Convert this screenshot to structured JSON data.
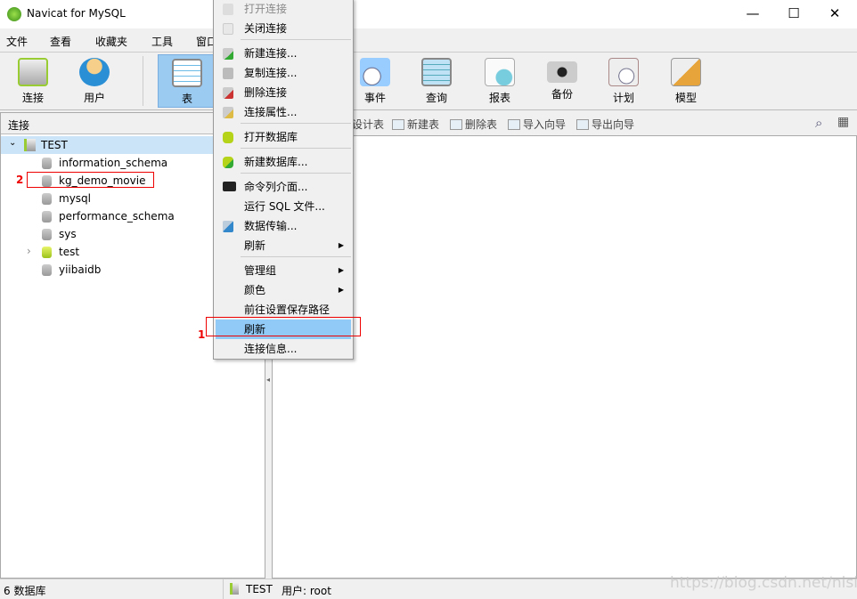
{
  "window": {
    "title": "Navicat for MySQL",
    "minimize": "—",
    "maximize": "☐",
    "close": "✕"
  },
  "menubar": [
    "文件",
    "查看",
    "收藏夹",
    "工具",
    "窗口"
  ],
  "toolbar": {
    "left": [
      {
        "label": "连接",
        "icon": "connection-icon"
      },
      {
        "label": "用户",
        "icon": "user-icon"
      },
      {
        "label": "表",
        "icon": "table-icon",
        "selected": true
      }
    ],
    "right": [
      {
        "label": "事件",
        "icon": "event-icon"
      },
      {
        "label": "查询",
        "icon": "query-icon"
      },
      {
        "label": "报表",
        "icon": "report-icon"
      },
      {
        "label": "备份",
        "icon": "backup-icon"
      },
      {
        "label": "计划",
        "icon": "schedule-icon"
      },
      {
        "label": "模型",
        "icon": "model-icon"
      }
    ]
  },
  "left_panel": {
    "header": "连接",
    "connection": "TEST",
    "databases": [
      "information_schema",
      "kg_demo_movie",
      "mysql",
      "performance_schema",
      "sys",
      "test",
      "yiibaidb"
    ]
  },
  "sub_toolbar": [
    "设计表",
    "新建表",
    "删除表",
    "导入向导",
    "导出向导"
  ],
  "context_menu": [
    {
      "label": "打开连接",
      "disabled": true
    },
    {
      "label": "关闭连接"
    },
    {
      "sep": true
    },
    {
      "label": "新建连接..."
    },
    {
      "label": "复制连接..."
    },
    {
      "label": "删除连接"
    },
    {
      "label": "连接属性..."
    },
    {
      "sep": true
    },
    {
      "label": "打开数据库"
    },
    {
      "sep": true
    },
    {
      "label": "新建数据库..."
    },
    {
      "sep": true
    },
    {
      "label": "命令列介面..."
    },
    {
      "label": "运行 SQL 文件..."
    },
    {
      "label": "数据传输..."
    },
    {
      "label": "刷新",
      "submenu": true
    },
    {
      "sep": true
    },
    {
      "label": "管理组",
      "submenu": true
    },
    {
      "label": "颜色",
      "submenu": true
    },
    {
      "label": "前往设置保存路径"
    },
    {
      "label": "刷新",
      "highlighted": true
    },
    {
      "label": "连接信息..."
    }
  ],
  "annotations": {
    "one": "1",
    "two": "2",
    "color": "#e00000"
  },
  "statusbar": {
    "db_count": "6 数据库",
    "connection": "TEST",
    "user": "用户: root"
  },
  "watermark": "https://blog.csdn.net/nisite_J",
  "colors": {
    "selection": "#91c9f7",
    "tree_selected": "#cce4f7"
  }
}
